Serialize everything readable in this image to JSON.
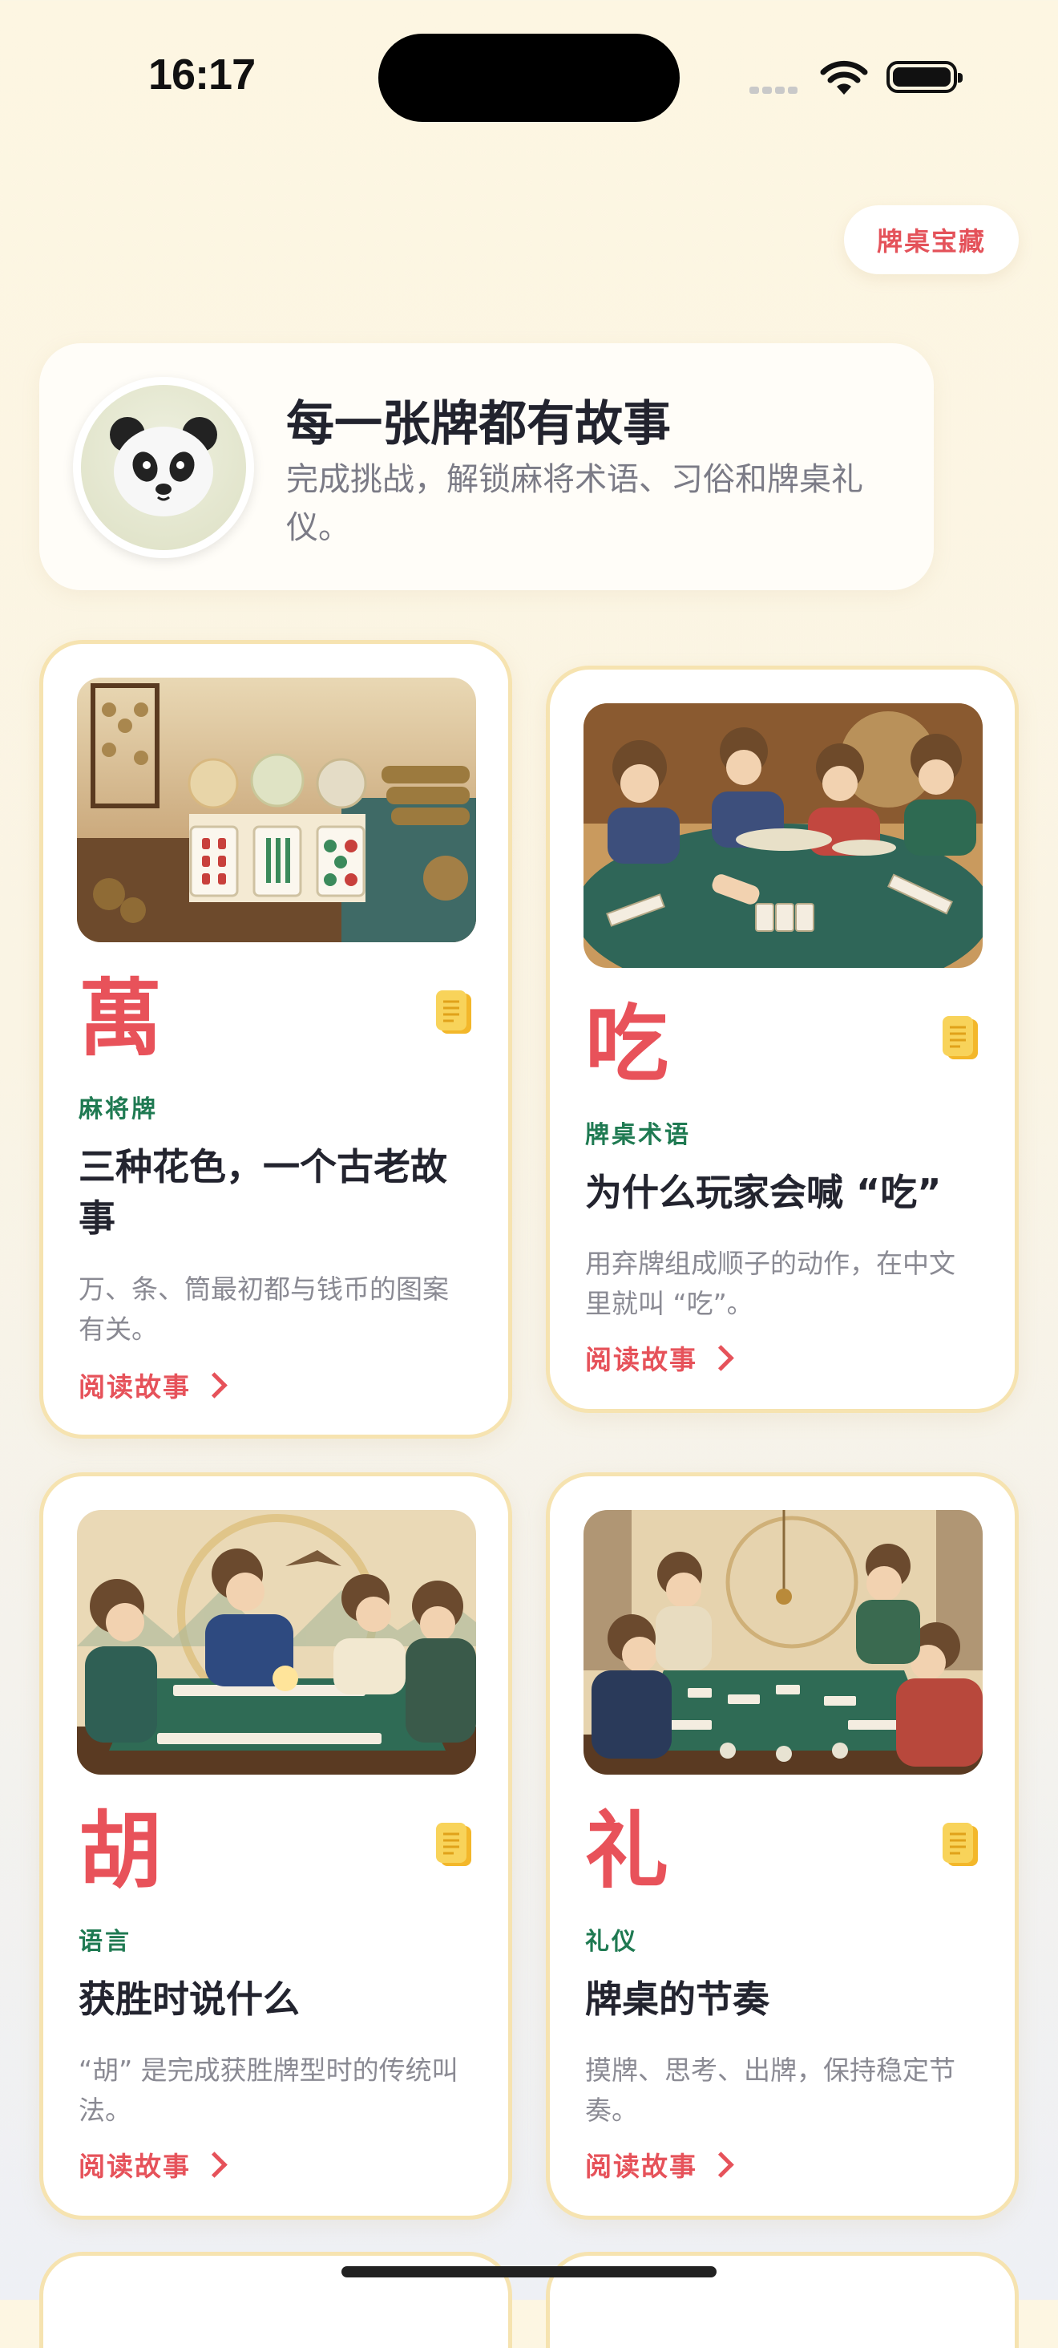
{
  "status_bar": {
    "time": "16:17"
  },
  "header": {
    "treasure_button": "牌桌宝藏"
  },
  "hero": {
    "avatar_emoji": "🐼",
    "title": "每一张牌都有故事",
    "subtitle": "完成挑战，解锁麻将术语、习俗和牌桌礼仪。"
  },
  "cards": [
    {
      "glyph": "萬",
      "category": "麻将牌",
      "title": "三种花色，一个古老故事",
      "description": "万、条、筒最初都与钱币的图案有关。",
      "read_label": "阅读故事"
    },
    {
      "glyph": "吃",
      "category": "牌桌术语",
      "title": "为什么玩家会喊 “吃”",
      "description": "用弃牌组成顺子的动作，在中文里就叫 “吃”。",
      "read_label": "阅读故事"
    },
    {
      "glyph": "胡",
      "category": "语言",
      "title": "获胜时说什么",
      "description": "“胡” 是完成获胜牌型时的传统叫法。",
      "read_label": "阅读故事"
    },
    {
      "glyph": "礼",
      "category": "礼仪",
      "title": "牌桌的节奏",
      "description": "摸牌、思考、出牌，保持稳定节奏。",
      "read_label": "阅读故事"
    }
  ],
  "colors": {
    "accent_red": "#e6525a",
    "category_green": "#1f7a52",
    "card_border": "#f6e3b0"
  }
}
